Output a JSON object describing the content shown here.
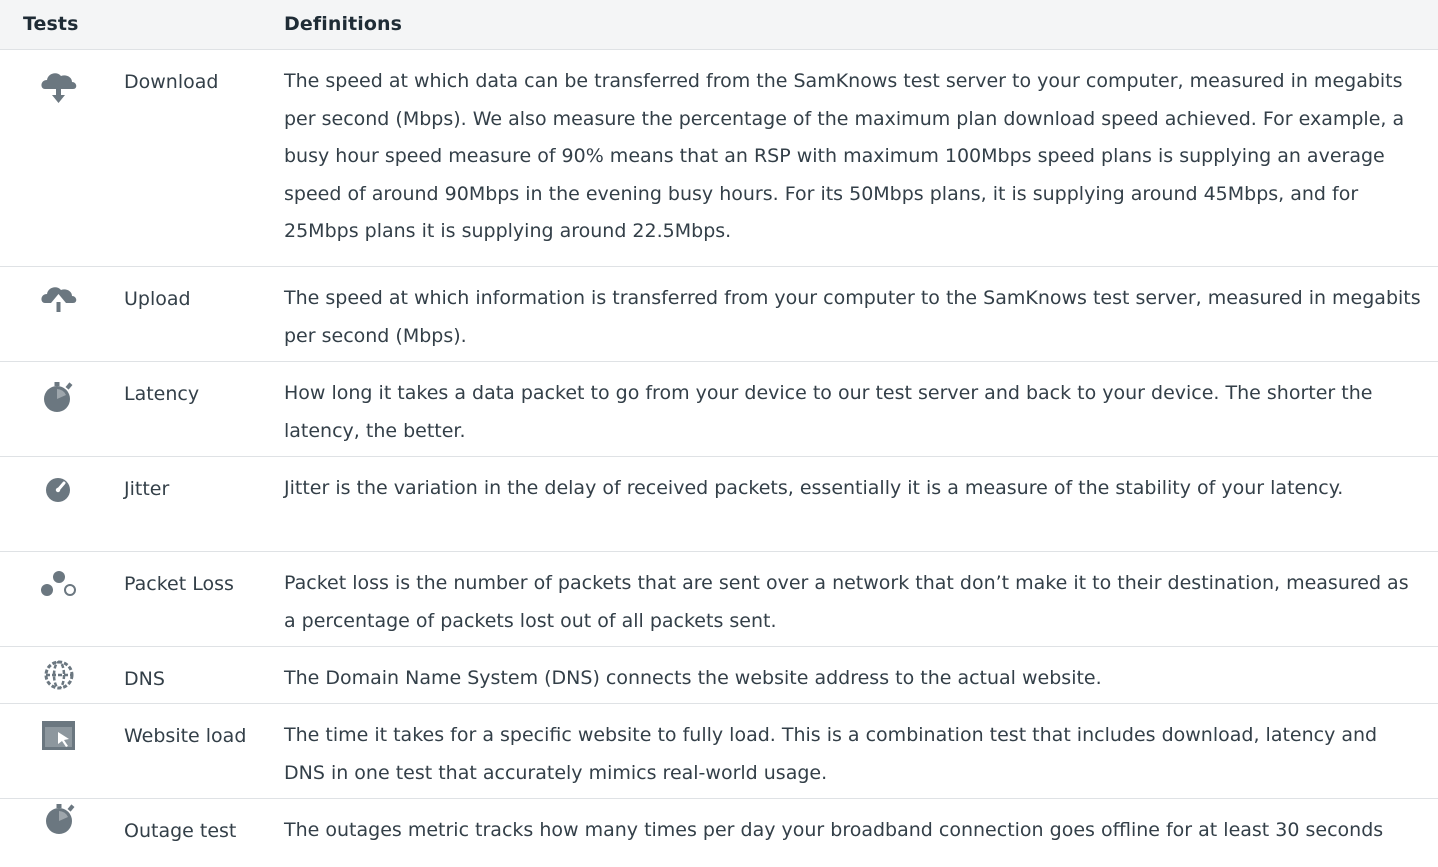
{
  "header": {
    "tests_label": "Tests",
    "definitions_label": "Definitions"
  },
  "rows": [
    {
      "icon": "cloud-download-icon",
      "name": "Download",
      "definition": "The speed at which data can be transferred from the SamKnows test server to your computer, measured in megabits per second (Mbps). We also measure the percentage of the maximum plan download speed achieved. For example, a busy hour speed measure of 90% means that an RSP with maximum 100Mbps speed plans is supplying an average speed of around 90Mbps in the evening busy hours. For its 50Mbps plans, it is supplying around 45Mbps, and for 25Mbps plans it is supplying around 22.5Mbps."
    },
    {
      "icon": "cloud-upload-icon",
      "name": "Upload",
      "definition": "The speed at which information is transferred from your computer to the SamKnows test server, measured in megabits per second (Mbps)."
    },
    {
      "icon": "stopwatch-icon",
      "name": "Latency",
      "definition": "How long it takes a data packet to go from your device to our test server and back to your device. The shorter the latency, the better."
    },
    {
      "icon": "gauge-icon",
      "name": "Jitter",
      "definition": "Jitter is the variation in the delay of received packets, essentially it is a measure of the stability of your latency."
    },
    {
      "icon": "packet-loss-icon",
      "name": "Packet Loss",
      "definition": "Packet loss is the number of packets that are sent over a network that don’t make it to their destination, measured as a percentage of packets lost out of all packets sent."
    },
    {
      "icon": "globe-icon",
      "name": "DNS",
      "definition": "The Domain Name System (DNS) connects the website address to the actual website."
    },
    {
      "icon": "website-load-icon",
      "name": "Website load",
      "definition": "The time it takes for a specific website to fully load. This is a combination test that includes download, latency and DNS in one test that accurately mimics real-world usage."
    },
    {
      "icon": "stopwatch-icon",
      "name": "Outage test",
      "definition": "The outages metric tracks how many times per day your broadband connection goes offline for at least 30 seconds"
    }
  ],
  "colors": {
    "icon": "#6b7780",
    "text": "#333f48",
    "header_bg": "#f4f5f6",
    "divider": "#dfe2e5"
  }
}
